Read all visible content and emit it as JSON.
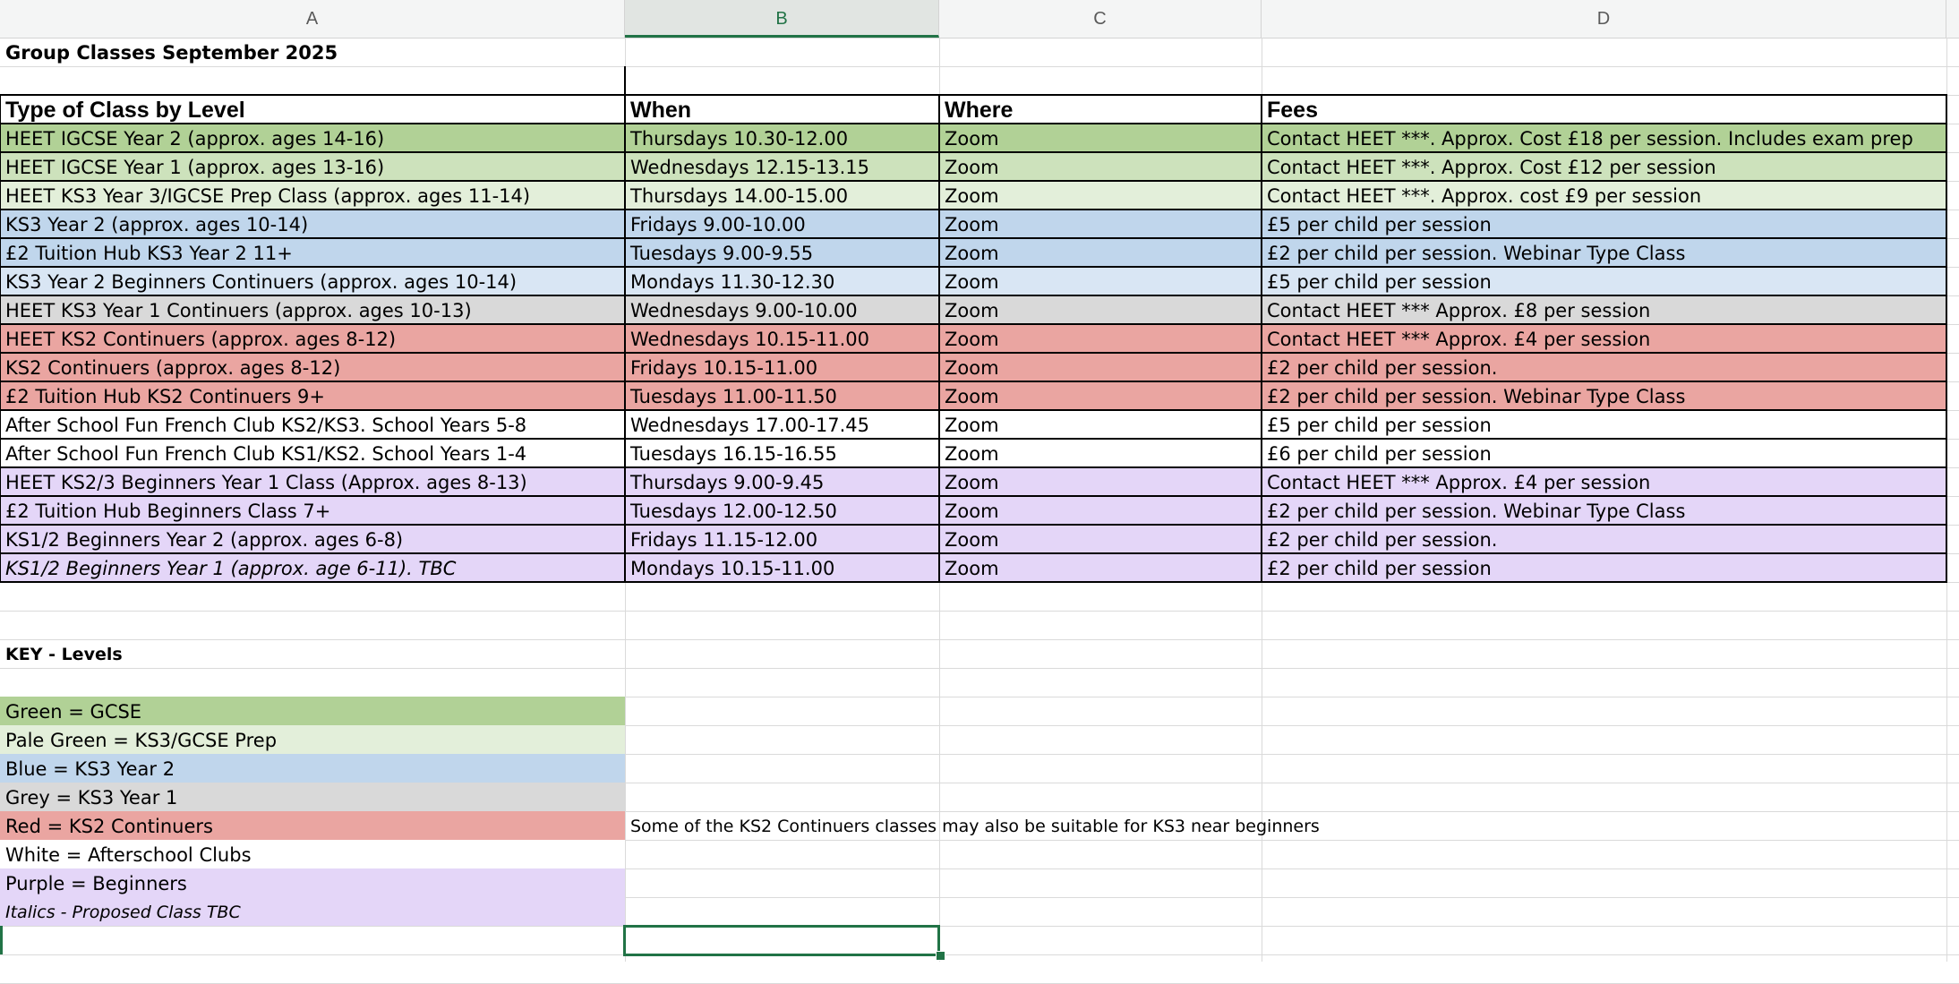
{
  "columns": [
    {
      "letter": "A",
      "selected": false
    },
    {
      "letter": "B",
      "selected": true
    },
    {
      "letter": "C",
      "selected": false
    },
    {
      "letter": "D",
      "selected": false
    }
  ],
  "sheet_title": "Group Classes September 2025",
  "table": {
    "headers": [
      "Type of Class by Level",
      "When",
      "Where",
      "Fees"
    ],
    "rows": [
      {
        "class": "HEET IGCSE Year 2 (approx. ages 14-16)",
        "when": "Thursdays 10.30-12.00",
        "where": "Zoom",
        "fees": "Contact HEET ***. Approx. Cost £18 per session.  Includes exam prep",
        "color": "#b1d196",
        "italic": false
      },
      {
        "class": "HEET IGCSE Year 1 (approx. ages 13-16)",
        "when": "Wednesdays 12.15-13.15",
        "where": "Zoom",
        "fees": "Contact HEET ***. Approx. Cost £12 per session",
        "color": "#cde2bc",
        "italic": false
      },
      {
        "class": "HEET KS3 Year 3/IGCSE Prep Class (approx. ages 11-14)",
        "when": "Thursdays 14.00-15.00",
        "where": "Zoom",
        "fees": "Contact HEET ***. Approx. cost £9 per session",
        "color": "#e3efda",
        "italic": false
      },
      {
        "class": "KS3 Year 2 (approx. ages 10-14)",
        "when": "Fridays 9.00-10.00",
        "where": "Zoom",
        "fees": "£5 per child per session",
        "color": "#c0d6ec",
        "italic": false
      },
      {
        "class": "£2 Tuition Hub KS3 Year 2 11+",
        "when": "Tuesdays 9.00-9.55",
        "where": "Zoom",
        "fees": "£2 per child per session.  Webinar Type Class",
        "color": "#c0d6ec",
        "italic": false
      },
      {
        "class": "KS3 Year 2 Beginners Continuers (approx. ages 10-14)",
        "when": "Mondays 11.30-12.30",
        "where": "Zoom",
        "fees": "£5 per child per session",
        "color": "#d9e6f4",
        "italic": false
      },
      {
        "class": "HEET KS3 Year 1 Continuers (approx. ages 10-13)",
        "when": "Wednesdays 9.00-10.00",
        "where": "Zoom",
        "fees": "Contact HEET *** Approx. £8 per session",
        "color": "#d9d9d9",
        "italic": false
      },
      {
        "class": "HEET KS2 Continuers (approx. ages 8-12)",
        "when": "Wednesdays 10.15-11.00",
        "where": "Zoom",
        "fees": "Contact HEET *** Approx. £4 per session",
        "color": "#eaa5a1",
        "italic": false
      },
      {
        "class": "KS2 Continuers (approx. ages 8-12)",
        "when": "Fridays 10.15-11.00",
        "where": "Zoom",
        "fees": "£2 per child per session.",
        "color": "#eaa5a1",
        "italic": false
      },
      {
        "class": "£2 Tuition Hub KS2 Continuers 9+",
        "when": "Tuesdays 11.00-11.50",
        "where": "Zoom",
        "fees": "£2 per child per session.  Webinar Type Class",
        "color": "#eaa5a1",
        "italic": false
      },
      {
        "class": "After School Fun French Club KS2/KS3.  School Years 5-8",
        "when": "Wednesdays 17.00-17.45",
        "where": "Zoom",
        "fees": "£5 per child per session",
        "color": "#ffffff",
        "italic": false
      },
      {
        "class": "After School Fun French Club KS1/KS2.  School Years 1-4",
        "when": "Tuesdays 16.15-16.55",
        "where": "Zoom",
        "fees": "£6 per child per session",
        "color": "#ffffff",
        "italic": false
      },
      {
        "class": "HEET KS2/3 Beginners Year 1 Class (Approx. ages 8-13)",
        "when": "Thursdays 9.00-9.45",
        "where": "Zoom",
        "fees": "Contact HEET *** Approx. £4 per session",
        "color": "#e4d6f8",
        "italic": false
      },
      {
        "class": "£2 Tuition Hub Beginners Class 7+",
        "when": "Tuesdays 12.00-12.50",
        "where": "Zoom",
        "fees": "£2 per child per session. Webinar Type Class",
        "color": "#e4d6f8",
        "italic": false
      },
      {
        "class": "KS1/2 Beginners Year 2  (approx. ages 6-8)",
        "when": "Fridays 11.15-12.00",
        "where": "Zoom",
        "fees": "£2 per child per session.",
        "color": "#e4d6f8",
        "italic": false
      },
      {
        "class": "KS1/2 Beginners Year 1 (approx. age 6-11). TBC",
        "when": "Mondays 10.15-11.00",
        "where": "Zoom",
        "fees": "£2 per child per session",
        "color": "#e4d6f8",
        "italic": true
      }
    ]
  },
  "key": {
    "title": "KEY - Levels",
    "items": [
      {
        "label": "Green = GCSE",
        "color": "#b1d196",
        "italic": false
      },
      {
        "label": "Pale Green = KS3/GCSE Prep",
        "color": "#e3efda",
        "italic": false
      },
      {
        "label": "Blue = KS3 Year 2",
        "color": "#c0d6ec",
        "italic": false
      },
      {
        "label": "Grey = KS3 Year 1",
        "color": "#d9d9d9",
        "italic": false
      },
      {
        "label": "Red = KS2 Continuers",
        "color": "#eaa5a1",
        "italic": false
      },
      {
        "label": "White = Afterschool Clubs",
        "color": "#ffffff",
        "italic": false
      },
      {
        "label": "Purple = Beginners",
        "color": "#e4d6f8",
        "italic": false
      },
      {
        "label": "Italics - Proposed Class TBC",
        "color": "#e4d6f8",
        "italic": true
      }
    ],
    "note": "Some of the KS2 Continuers classes may also be suitable for KS3 near beginners"
  },
  "colors": {
    "selection": "#217346",
    "grid": "#dadada",
    "header_bg": "#f4f5f5"
  }
}
